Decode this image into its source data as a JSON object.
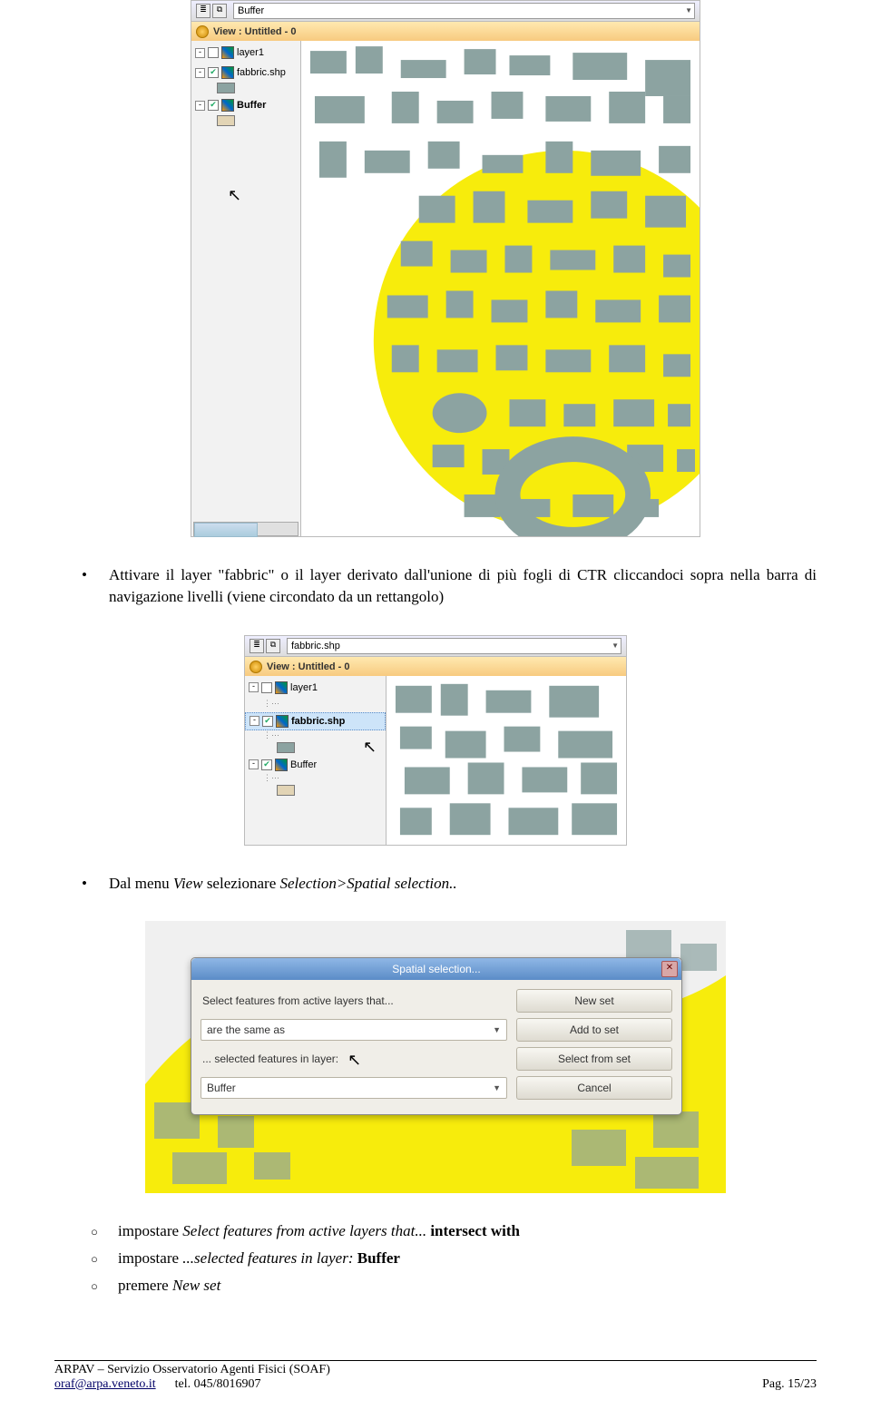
{
  "fig1": {
    "toolbar_value": "Buffer",
    "view_title": "View : Untitled - 0",
    "layers": [
      {
        "name": "layer1",
        "checked": false,
        "bold": false,
        "swatch": ""
      },
      {
        "name": "fabbric.shp",
        "checked": true,
        "bold": false,
        "swatch": "#8ca3a1"
      },
      {
        "name": "Buffer",
        "checked": true,
        "bold": true,
        "swatch": "#e2d4b5"
      }
    ]
  },
  "bullet1": {
    "pre": "Attivare il layer \"fabbric\" o il layer derivato dall'unione di più fogli di CTR cliccandoci sopra nella barra di navigazione livelli (viene circondato da un rettangolo)"
  },
  "fig2": {
    "toolbar_value": "fabbric.shp",
    "view_title": "View : Untitled - 0",
    "layers": [
      {
        "name": "layer1",
        "checked": false,
        "bold": false,
        "swatch": ""
      },
      {
        "name": "fabbric.shp",
        "checked": true,
        "bold": true,
        "swatch": "#8ca3a1"
      },
      {
        "name": "Buffer",
        "checked": true,
        "bold": false,
        "swatch": "#e2d4b5"
      }
    ]
  },
  "bullet2": {
    "pre": "Dal menu ",
    "it1": "View",
    "mid": " selezionare ",
    "it2": "Selection>Spatial selection.."
  },
  "dialog": {
    "title": "Spatial selection...",
    "label1": "Select features from active layers that...",
    "field1": "are the same as",
    "label2": "... selected features in layer:",
    "field2": "Buffer",
    "btn1": "New set",
    "btn2": "Add to set",
    "btn3": "Select from set",
    "btn4": "Cancel"
  },
  "sub": {
    "s1_pre": "impostare ",
    "s1_it": "Select features from active layers that...",
    "s1_bold": " intersect with",
    "s2_pre": "impostare ",
    "s2_it": "...selected features in layer: ",
    "s2_bold": "Buffer",
    "s3_pre": "premere ",
    "s3_it": "New set"
  },
  "footer": {
    "org": "ARPAV – Servizio Osservatorio Agenti Fisici (SOAF)",
    "email": "oraf@arpa.veneto.it",
    "tel_lbl": "tel. ",
    "tel": "045/8016907",
    "page": "Pag. 15/23"
  },
  "swatch_colors": {
    "fabbric": "#8ca3a1",
    "buffer": "#e2d4b5"
  }
}
